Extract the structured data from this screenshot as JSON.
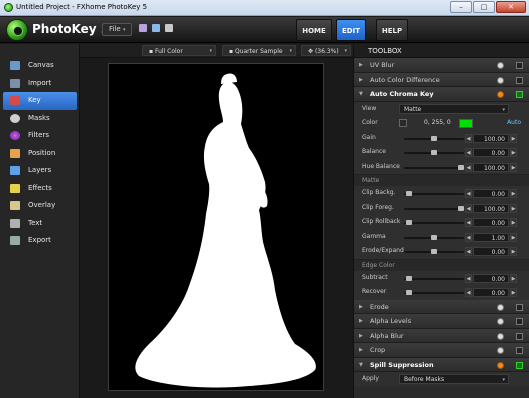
{
  "window": {
    "title": "Untitled Project - FXhome PhotoKey 5",
    "min": "–",
    "max": "□",
    "close": "✕"
  },
  "app": {
    "name": "PhotoKey",
    "version": "5",
    "file_menu": "File",
    "file_arrow": "▾"
  },
  "nav": {
    "home": "HOME",
    "edit": "EDIT",
    "help": "HELP"
  },
  "sidebar": {
    "items": [
      {
        "label": "Canvas",
        "icon": "canvas-icon",
        "color": "#6a9acb"
      },
      {
        "label": "Import",
        "icon": "import-icon",
        "color": "#7c8fa8"
      },
      {
        "label": "Key",
        "icon": "key-icon",
        "color": "#d84a4a"
      },
      {
        "label": "Masks",
        "icon": "masks-icon",
        "color": "#cfcfcf"
      },
      {
        "label": "Filters",
        "icon": "filters-icon",
        "color": "#c94fd6"
      },
      {
        "label": "Position",
        "icon": "position-icon",
        "color": "#e8a24a"
      },
      {
        "label": "Layers",
        "icon": "layers-icon",
        "color": "#5fa0e8"
      },
      {
        "label": "Effects",
        "icon": "effects-icon",
        "color": "#e8d04a"
      },
      {
        "label": "Overlay",
        "icon": "overlay-icon",
        "color": "#d8c88a"
      },
      {
        "label": "Text",
        "icon": "text-icon",
        "color": "#b0b0b0"
      },
      {
        "label": "Export",
        "icon": "export-icon",
        "color": "#9aa"
      }
    ],
    "active_index": 2
  },
  "viewbar": {
    "mode": "Full Color",
    "sample": "Quarter Sample",
    "zoom": "(36.3%)",
    "arrow": "▾"
  },
  "toolbox": {
    "title": "TOOLBOX",
    "collapsed_arrow": "▶",
    "expanded_arrow": "▼",
    "top_filters": [
      "UV Blur",
      "Auto Color Difference"
    ],
    "chroma": {
      "title": "Auto Chroma Key",
      "view_label": "View",
      "view_value": "Matte",
      "color_label": "Color",
      "color_value": "0, 255, 0",
      "color_swatch": "#00e000",
      "auto_label": "Auto",
      "params": [
        {
          "label": "Gain",
          "value": "100.00",
          "pos": 0.45
        },
        {
          "label": "Balance",
          "value": "0.00",
          "pos": 0.5
        },
        {
          "label": "Hue Balance",
          "value": "100.00",
          "pos": 0.95
        }
      ],
      "matte_title": "Matte",
      "matte_params": [
        {
          "label": "Clip Backg.",
          "value": "0.00",
          "pos": 0.05
        },
        {
          "label": "Clip Foreg.",
          "value": "100.00",
          "pos": 0.95
        },
        {
          "label": "Clip Rollback",
          "value": "0.00",
          "pos": 0.05
        },
        {
          "label": "Gamma",
          "value": "1.00",
          "pos": 0.5
        },
        {
          "label": "Erode/Expand",
          "value": "0.00",
          "pos": 0.5
        }
      ],
      "edge_title": "Edge Color",
      "edge_params": [
        {
          "label": "Subtract",
          "value": "0.00",
          "pos": 0.05
        },
        {
          "label": "Recover",
          "value": "0.00",
          "pos": 0.05
        }
      ]
    },
    "lower_filters": [
      "Erode",
      "Alpha Levels",
      "Alpha Blur",
      "Crop"
    ],
    "spill": {
      "title": "Spill Suppression",
      "apply_label": "Apply",
      "apply_value": "Before Masks"
    }
  },
  "spin": {
    "left": "◀",
    "right": "▶"
  }
}
